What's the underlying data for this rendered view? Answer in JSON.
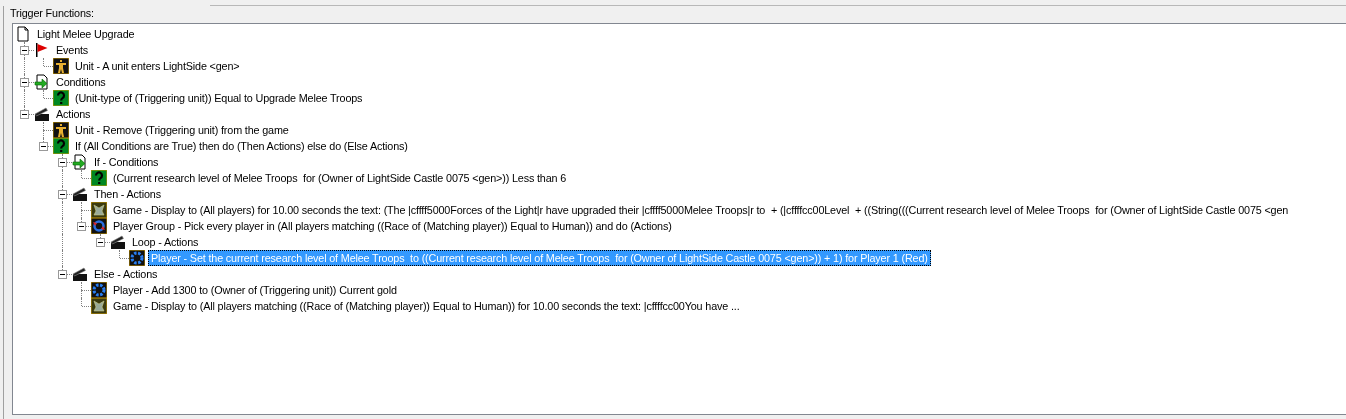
{
  "panel": {
    "label": "Trigger Functions:"
  },
  "tree": [
    {
      "kind": "trigger",
      "label": "Light Melee Upgrade",
      "selected": false,
      "children": [
        {
          "kind": "events",
          "label": "Events",
          "selected": false,
          "expanded": true,
          "children": [
            {
              "kind": "unit",
              "label": "Unit - A unit enters LightSide <gen>",
              "selected": false
            }
          ]
        },
        {
          "kind": "conditions",
          "label": "Conditions",
          "selected": false,
          "expanded": true,
          "children": [
            {
              "kind": "question",
              "label": "(Unit-type of (Triggering unit)) Equal to Upgrade Melee Troops",
              "selected": false
            }
          ]
        },
        {
          "kind": "actions",
          "label": "Actions",
          "selected": false,
          "expanded": true,
          "children": [
            {
              "kind": "unit",
              "label": "Unit - Remove (Triggering unit) from the game",
              "selected": false
            },
            {
              "kind": "question",
              "label": "If (All Conditions are True) then do (Then Actions) else do (Else Actions)",
              "selected": false,
              "expanded": true,
              "children": [
                {
                  "kind": "conditions",
                  "label": "If - Conditions",
                  "selected": false,
                  "expanded": true,
                  "children": [
                    {
                      "kind": "question",
                      "label": "(Current research level of Melee Troops  for (Owner of LightSide Castle 0075 <gen>)) Less than 6",
                      "selected": false
                    }
                  ]
                },
                {
                  "kind": "actions",
                  "label": "Then - Actions",
                  "selected": false,
                  "expanded": true,
                  "children": [
                    {
                      "kind": "game",
                      "label": "Game - Display to (All players) for 10.00 seconds the text: (The |cffff5000Forces of the Light|r have upgraded their |cffff5000Melee Troops|r to  + (|cffffcc00Level  + ((String(((Current research level of Melee Troops  for (Owner of LightSide Castle 0075 <gen",
                      "selected": false
                    },
                    {
                      "kind": "group",
                      "label": "Player Group - Pick every player in (All players matching ((Race of (Matching player)) Equal to Human)) and do (Actions)",
                      "selected": false,
                      "expanded": true,
                      "children": [
                        {
                          "kind": "actions",
                          "label": "Loop - Actions",
                          "selected": false,
                          "expanded": true,
                          "children": [
                            {
                              "kind": "player",
                              "label": "Player - Set the current research level of Melee Troops  to ((Current research level of Melee Troops  for (Owner of LightSide Castle 0075 <gen>)) + 1) for Player 1 (Red)",
                              "selected": true
                            }
                          ]
                        }
                      ]
                    }
                  ]
                },
                {
                  "kind": "actions",
                  "label": "Else - Actions",
                  "selected": false,
                  "expanded": true,
                  "children": [
                    {
                      "kind": "player",
                      "label": "Player - Add 1300 to (Owner of (Triggering unit)) Current gold",
                      "selected": false
                    },
                    {
                      "kind": "game",
                      "label": "Game - Display to (All players matching ((Race of (Matching player)) Equal to Human)) for 10.00 seconds the text: |cffffcc00You have ...",
                      "selected": false
                    }
                  ]
                }
              ]
            }
          ]
        }
      ]
    }
  ]
}
